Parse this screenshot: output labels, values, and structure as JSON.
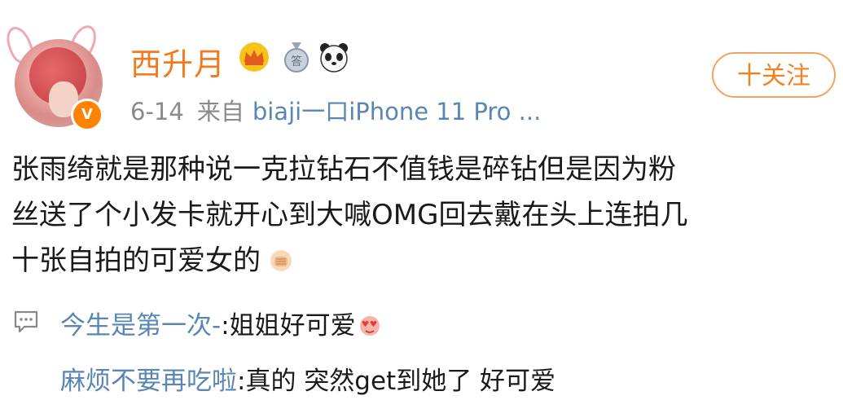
{
  "post": {
    "username": "西升月",
    "date": "6-14",
    "source_prefix": "来自",
    "source": "biaji一口iPhone 11 Pro ...",
    "follow_label": "十关注",
    "body_lines": [
      "张雨绮就是那种说一克拉钻石不值钱是碎钻但是因为粉",
      "丝送了个小发卡就开心到大喊OMG回去戴在头上连拍几",
      "十张自拍的可爱女的"
    ],
    "badges": [
      "crown-icon",
      "medal-icon",
      "panda-icon"
    ]
  },
  "comments": [
    {
      "author": "今生是第一次-",
      "text": ":姐姐好可爱"
    },
    {
      "author": "麻烦不要再吃啦",
      "text": ":真的 突然get到她了 好可爱"
    }
  ],
  "colors": {
    "accent": "#f27b20",
    "link": "#5a86b5",
    "meta": "#8a8a8a",
    "verified": "#ff8200"
  }
}
